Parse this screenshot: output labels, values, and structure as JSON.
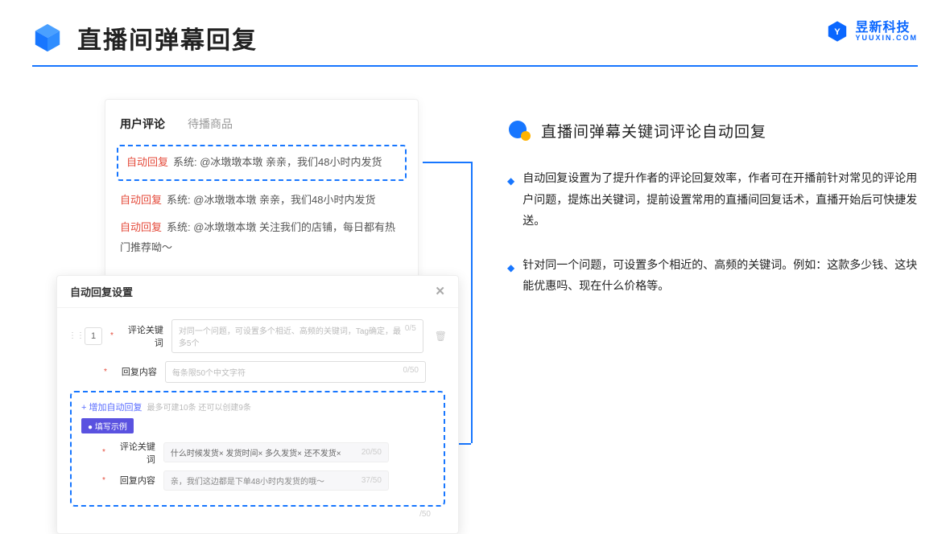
{
  "page_title": "直播间弹幕回复",
  "brand": {
    "cn": "昱新科技",
    "en": "YUUXIN.COM"
  },
  "card1": {
    "tab_active": "用户评论",
    "tab_other": "待播商品",
    "highlighted": {
      "tag": "自动回复",
      "text": "系统: @冰墩墩本墩 亲亲，我们48小时内发货"
    },
    "rows": [
      {
        "tag": "自动回复",
        "text": "系统: @冰墩墩本墩 亲亲，我们48小时内发货"
      },
      {
        "tag": "自动回复",
        "text": "系统: @冰墩墩本墩 关注我们的店铺，每日都有热门推荐呦～"
      }
    ]
  },
  "card2": {
    "title": "自动回复设置",
    "row_num": "1",
    "labels": {
      "keyword": "评论关键词",
      "content": "回复内容"
    },
    "placeholders": {
      "keyword": "对同一个问题，可设置多个相近、高频的关键词，Tag确定，最多5个",
      "content": "每条限50个中文字符"
    },
    "counters": {
      "kw": "0/5",
      "content": "0/50"
    },
    "add_link": "+ 增加自动回复",
    "add_note": "最多可建10条 还可以创建9条",
    "example_tag": "● 填写示例",
    "ex_kw_label": "评论关键词",
    "ex_content_label": "回复内容",
    "ex_tags": [
      "什么时候发货×",
      "发货时间×",
      "多久发货×",
      "还不发货×"
    ],
    "ex_kw_counter": "20/50",
    "ex_content": "亲，我们这边都是下单48小时内发货的哦～",
    "ex_content_counter": "37/50",
    "outer_counter": "/50"
  },
  "right": {
    "section_title": "直播间弹幕关键词评论自动回复",
    "bullets": [
      "自动回复设置为了提升作者的评论回复效率，作者可在开播前针对常见的评论用户问题，提炼出关键词，提前设置常用的直播间回复话术，直播开始后可快捷发送。",
      "针对同一个问题，可设置多个相近的、高频的关键词。例如：这款多少钱、这块能优惠吗、现在什么价格等。"
    ]
  }
}
